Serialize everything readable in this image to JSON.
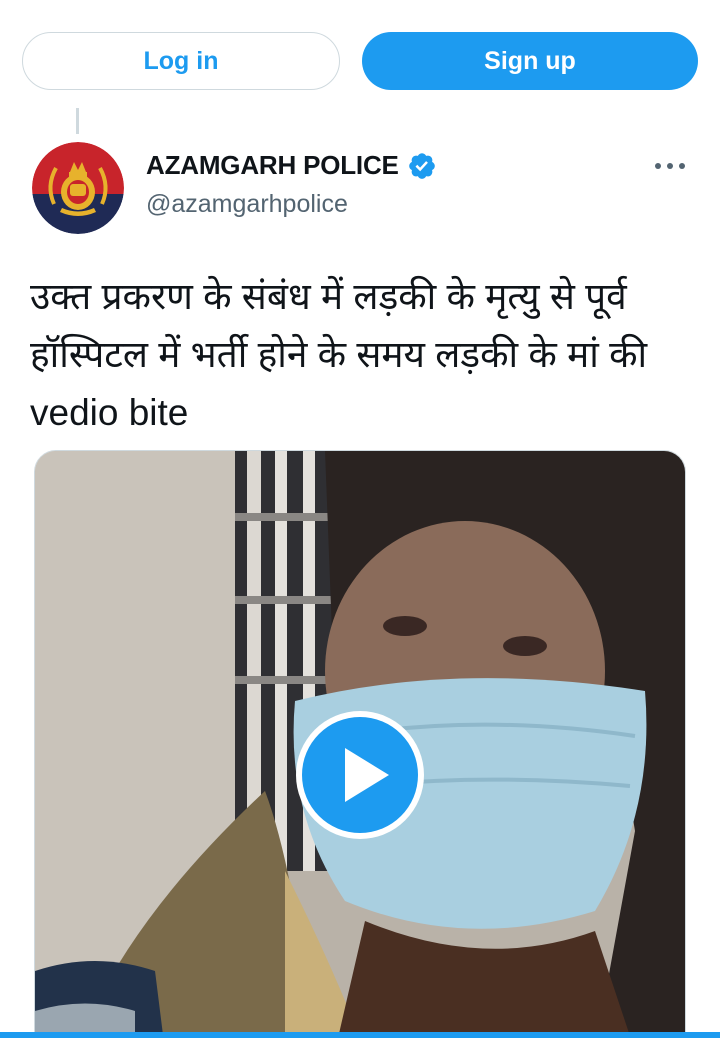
{
  "auth": {
    "login_label": "Log in",
    "signup_label": "Sign up"
  },
  "tweet": {
    "author_name": "AZAMGARH POLICE",
    "author_handle": "@azamgarhpolice",
    "verified": true,
    "text": "उक्त प्रकरण के संबंध में लड़की के मृत्यु से पूर्व हॉस्पिटल में भर्ती होने के समय लड़की के मां की vedio bite",
    "media_type": "video"
  },
  "icons": {
    "verified": "verified-badge-icon",
    "more": "more-horizontal-icon",
    "play": "play-icon"
  },
  "colors": {
    "accent": "#1d9bf0",
    "text_primary": "#0f1419",
    "text_secondary": "#536471",
    "border": "#cfd9de"
  }
}
